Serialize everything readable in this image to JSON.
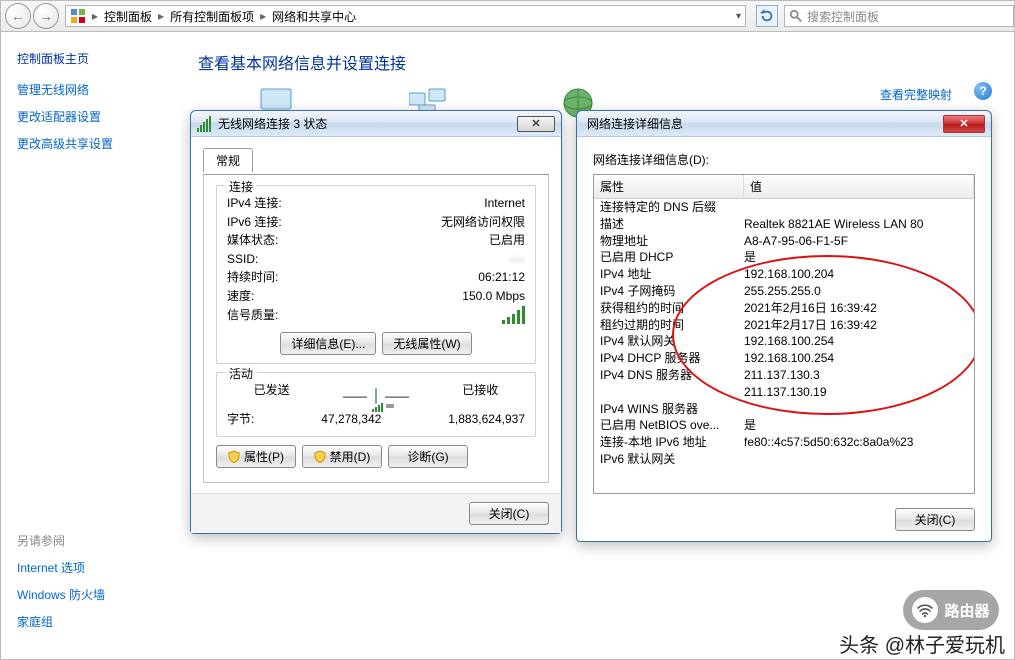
{
  "breadcrumbs": {
    "seg1": "控制面板",
    "seg2": "所有控制面板项",
    "seg3": "网络和共享中心"
  },
  "search": {
    "placeholder": "搜索控制面板"
  },
  "sidebar": {
    "header": "控制面板主页",
    "links": {
      "l1": "管理无线网络",
      "l2": "更改适配器设置",
      "l3": "更改高级共享设置"
    },
    "seealso_hdr": "另请参阅",
    "seealso": {
      "s1": "Internet 选项",
      "s2": "Windows 防火墙",
      "s3": "家庭组"
    }
  },
  "main": {
    "title": "查看基本网络信息并设置连接",
    "fullmap": "查看完整映射"
  },
  "status": {
    "title": "无线网络连接 3 状态",
    "tab": "常规",
    "grp_conn": "连接",
    "ipv4_l": "IPv4 连接:",
    "ipv4_v": "Internet",
    "ipv6_l": "IPv6 连接:",
    "ipv6_v": "无网络访问权限",
    "media_l": "媒体状态:",
    "media_v": "已启用",
    "ssid_l": "SSID:",
    "ssid_v": "····",
    "dur_l": "持续时间:",
    "dur_v": "06:21:12",
    "speed_l": "速度:",
    "speed_v": "150.0 Mbps",
    "sig_l": "信号质量:",
    "btn_details": "详细信息(E)...",
    "btn_wprops": "无线属性(W)",
    "grp_act": "活动",
    "sent": "已发送",
    "dash": "——",
    "recv": "已接收",
    "bytes_l": "字节:",
    "bytes_sent": "47,278,342",
    "bytes_recv": "1,883,624,937",
    "btn_props": "属性(P)",
    "btn_disable": "禁用(D)",
    "btn_diag": "诊断(G)",
    "btn_close": "关闭(C)"
  },
  "details": {
    "title": "网络连接详细信息",
    "label": "网络连接详细信息(D):",
    "hdr_prop": "属性",
    "hdr_val": "值",
    "rows": [
      {
        "p": "连接特定的 DNS 后缀",
        "v": ""
      },
      {
        "p": "描述",
        "v": "Realtek 8821AE Wireless LAN 80"
      },
      {
        "p": "物理地址",
        "v": "A8-A7-95-06-F1-5F"
      },
      {
        "p": "已启用 DHCP",
        "v": "是"
      },
      {
        "p": "IPv4 地址",
        "v": "192.168.100.204"
      },
      {
        "p": "IPv4 子网掩码",
        "v": "255.255.255.0"
      },
      {
        "p": "获得租约的时间",
        "v": "2021年2月16日 16:39:42"
      },
      {
        "p": "租约过期的时间",
        "v": "2021年2月17日 16:39:42"
      },
      {
        "p": "IPv4 默认网关",
        "v": "192.168.100.254"
      },
      {
        "p": "IPv4 DHCP 服务器",
        "v": "192.168.100.254"
      },
      {
        "p": "IPv4 DNS 服务器",
        "v": "211.137.130.3"
      },
      {
        "p": "",
        "v": "211.137.130.19"
      },
      {
        "p": "IPv4 WINS 服务器",
        "v": ""
      },
      {
        "p": "已启用 NetBIOS ove...",
        "v": "是"
      },
      {
        "p": "连接-本地 IPv6 地址",
        "v": "fe80::4c57:5d50:632c:8a0a%23"
      },
      {
        "p": "IPv6 默认网关",
        "v": ""
      }
    ],
    "btn_close": "关闭(C)"
  },
  "watermark": {
    "text": "头条 @林子爱玩机",
    "router": "路由器"
  }
}
